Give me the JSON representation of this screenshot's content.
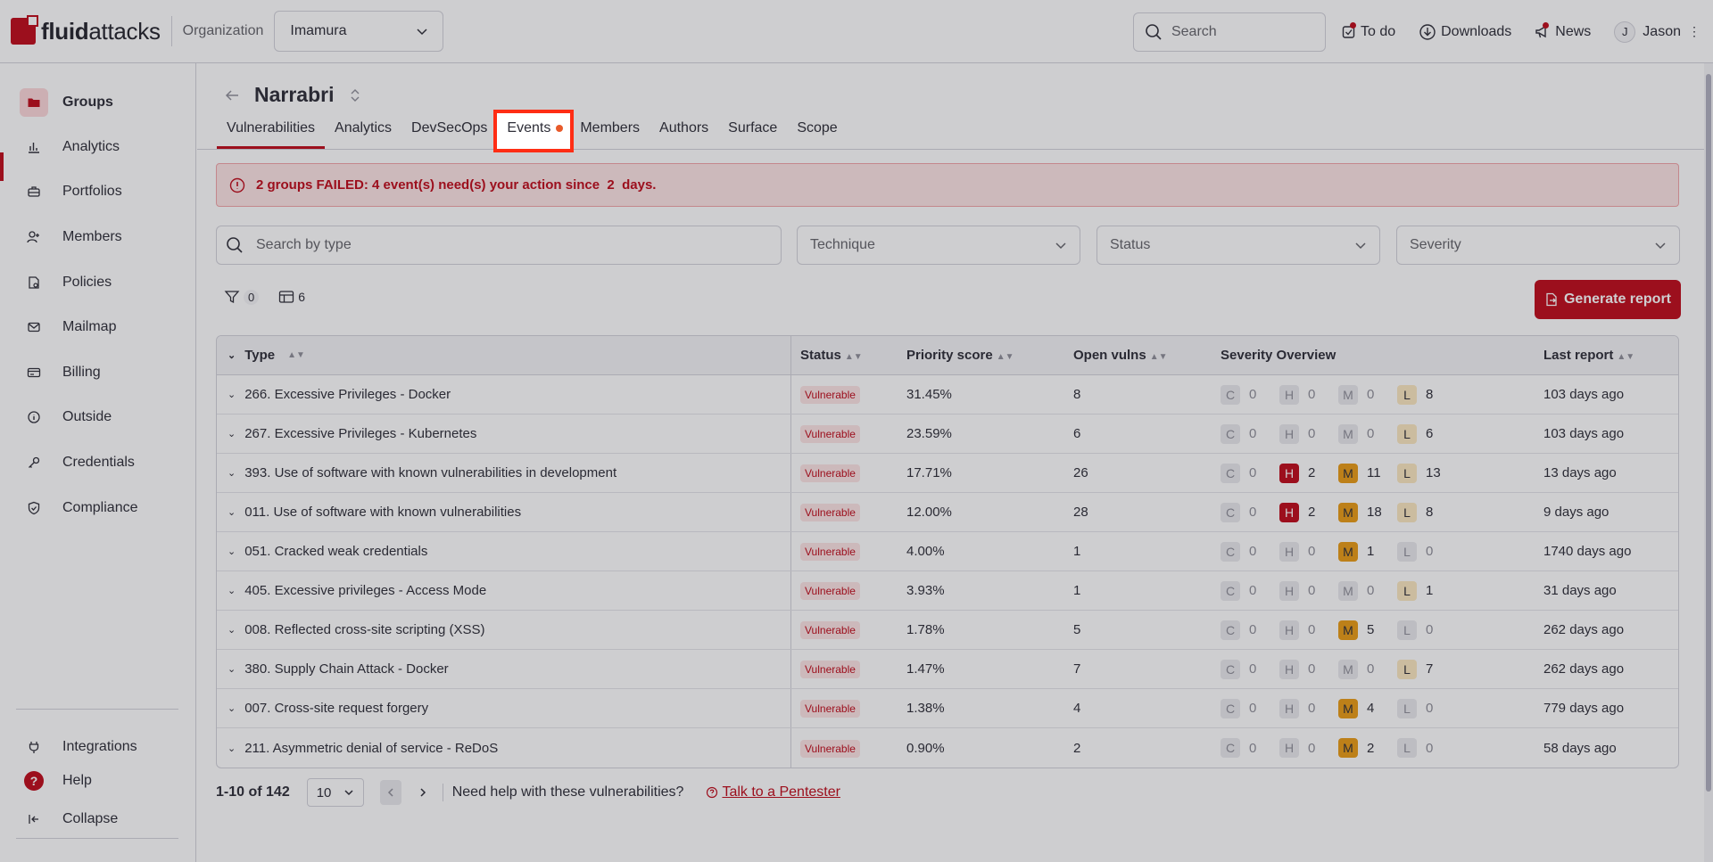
{
  "header": {
    "logo_text_bold": "fluid",
    "logo_text": "attacks",
    "org_label": "Organization",
    "org_value": "Imamura",
    "search_placeholder": "Search",
    "todo_label": "To do",
    "downloads_label": "Downloads",
    "news_label": "News",
    "user_initial": "J",
    "user_name": "Jason"
  },
  "sidebar": {
    "items": [
      {
        "label": "Groups",
        "icon": "folder-icon",
        "active": true
      },
      {
        "label": "Analytics",
        "icon": "bar-chart-icon"
      },
      {
        "label": "Portfolios",
        "icon": "briefcase-icon"
      },
      {
        "label": "Members",
        "icon": "user-plus-icon"
      },
      {
        "label": "Policies",
        "icon": "policy-icon"
      },
      {
        "label": "Mailmap",
        "icon": "mail-icon"
      },
      {
        "label": "Billing",
        "icon": "credit-card-icon"
      },
      {
        "label": "Outside",
        "icon": "info-icon"
      },
      {
        "label": "Credentials",
        "icon": "key-icon"
      },
      {
        "label": "Compliance",
        "icon": "shield-check-icon"
      }
    ],
    "bottom": {
      "integrations": "Integrations",
      "help": "Help",
      "collapse": "Collapse"
    }
  },
  "group": {
    "title": "Narrabri",
    "tabs": [
      "Vulnerabilities",
      "Analytics",
      "DevSecOps",
      "Events",
      "Members",
      "Authors",
      "Surface",
      "Scope"
    ]
  },
  "alert": {
    "text": "2 groups FAILED: 4 event(s) need(s) your action since  2  days."
  },
  "filters": {
    "search_placeholder": "Search by type",
    "technique": "Technique",
    "status": "Status",
    "severity": "Severity"
  },
  "toolbar": {
    "filter_count": "0",
    "columns_count": "6",
    "generate_report": "Generate report"
  },
  "table": {
    "headers": {
      "type": "Type",
      "status": "Status",
      "priority": "Priority score",
      "open": "Open vulns",
      "severity": "Severity Overview",
      "last": "Last report"
    },
    "rows": [
      {
        "type": "266. Excessive Privileges - Docker",
        "status": "Vulnerable",
        "priority": "31.45%",
        "open": "8",
        "c": "0",
        "h": "0",
        "m": "0",
        "l": "8",
        "last": "103 days ago"
      },
      {
        "type": "267. Excessive Privileges - Kubernetes",
        "status": "Vulnerable",
        "priority": "23.59%",
        "open": "6",
        "c": "0",
        "h": "0",
        "m": "0",
        "l": "6",
        "last": "103 days ago"
      },
      {
        "type": "393. Use of software with known vulnerabilities in development",
        "status": "Vulnerable",
        "priority": "17.71%",
        "open": "26",
        "c": "0",
        "h": "2",
        "m": "11",
        "l": "13",
        "last": "13 days ago"
      },
      {
        "type": "011. Use of software with known vulnerabilities",
        "status": "Vulnerable",
        "priority": "12.00%",
        "open": "28",
        "c": "0",
        "h": "2",
        "m": "18",
        "l": "8",
        "last": "9 days ago"
      },
      {
        "type": "051. Cracked weak credentials",
        "status": "Vulnerable",
        "priority": "4.00%",
        "open": "1",
        "c": "0",
        "h": "0",
        "m": "1",
        "l": "0",
        "last": "1740 days ago"
      },
      {
        "type": "405. Excessive privileges - Access Mode",
        "status": "Vulnerable",
        "priority": "3.93%",
        "open": "1",
        "c": "0",
        "h": "0",
        "m": "0",
        "l": "1",
        "last": "31 days ago"
      },
      {
        "type": "008. Reflected cross-site scripting (XSS)",
        "status": "Vulnerable",
        "priority": "1.78%",
        "open": "5",
        "c": "0",
        "h": "0",
        "m": "5",
        "l": "0",
        "last": "262 days ago"
      },
      {
        "type": "380. Supply Chain Attack - Docker",
        "status": "Vulnerable",
        "priority": "1.47%",
        "open": "7",
        "c": "0",
        "h": "0",
        "m": "0",
        "l": "7",
        "last": "262 days ago"
      },
      {
        "type": "007. Cross-site request forgery",
        "status": "Vulnerable",
        "priority": "1.38%",
        "open": "4",
        "c": "0",
        "h": "0",
        "m": "4",
        "l": "0",
        "last": "779 days ago"
      },
      {
        "type": "211. Asymmetric denial of service - ReDoS",
        "status": "Vulnerable",
        "priority": "0.90%",
        "open": "2",
        "c": "0",
        "h": "0",
        "m": "2",
        "l": "0",
        "last": "58 days ago"
      }
    ]
  },
  "pagination": {
    "range": "1-10 of 142",
    "page_size": "10",
    "help_text": "Need help with these vulnerabilities?",
    "pentester_link": "Talk to a Pentester"
  },
  "colors": {
    "brand_red": "#bf0b1a",
    "medium": "#e99c15",
    "low": "#fbe8c0",
    "highlight": "#ff2d14"
  }
}
